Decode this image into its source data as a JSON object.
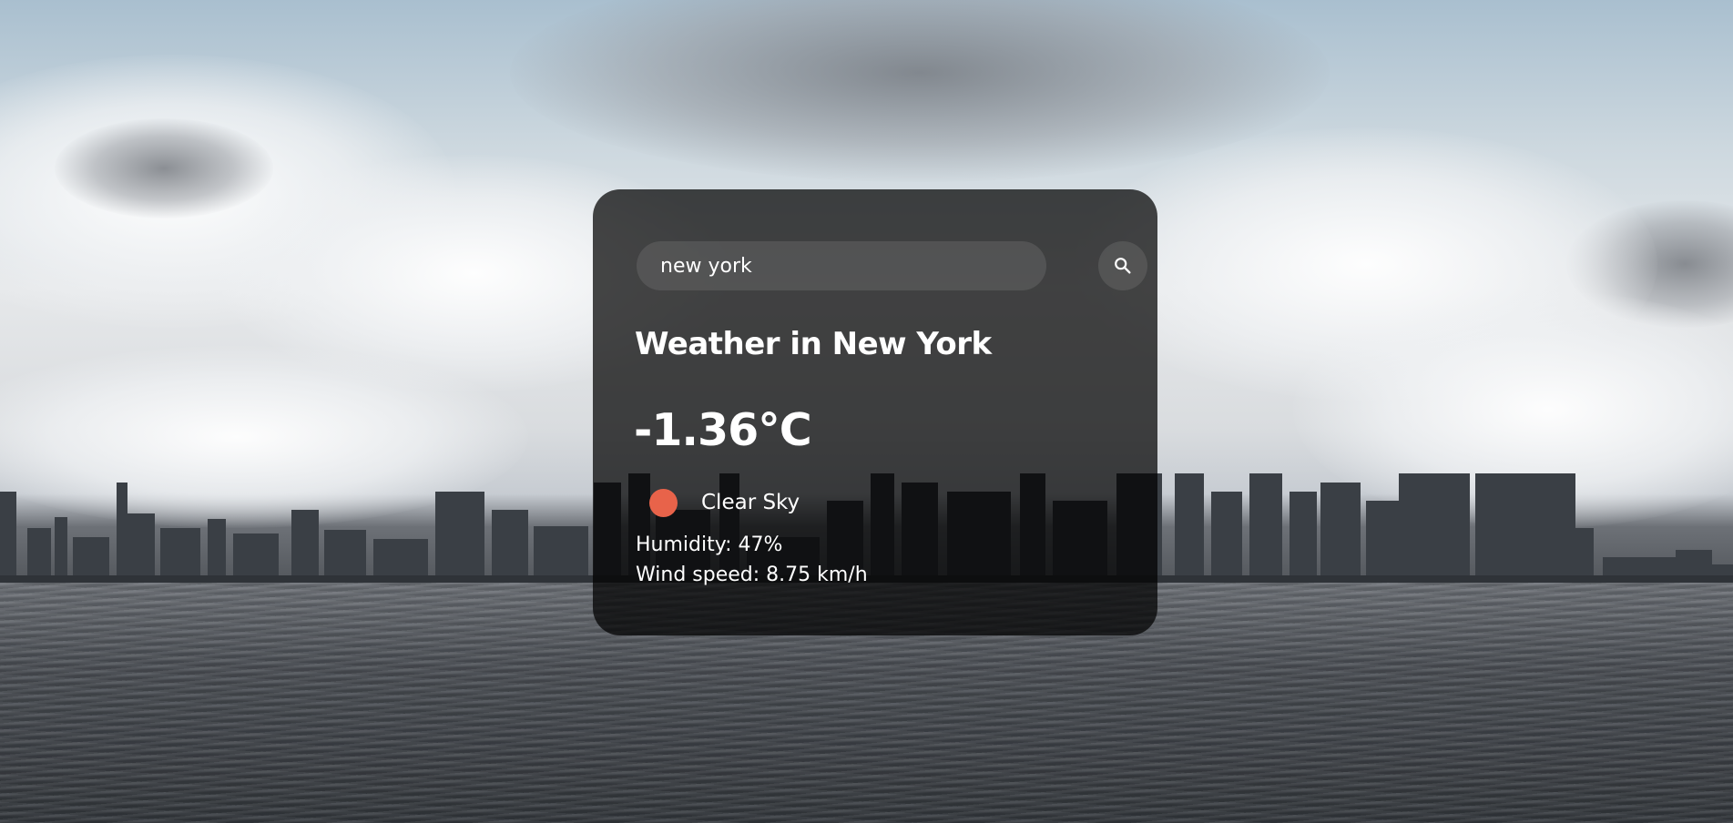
{
  "search": {
    "value": "new york",
    "icon": "search-icon"
  },
  "weather": {
    "title": "Weather in New York",
    "temperature": "-1.36°C",
    "description": "Clear Sky",
    "icon": "clear-sky-icon",
    "humidity": "Humidity: 47%",
    "wind": "Wind speed: 8.75 km/h"
  },
  "colors": {
    "card_background": "#000000b8",
    "weather_icon": "#e8634a",
    "text": "#ffffff"
  }
}
